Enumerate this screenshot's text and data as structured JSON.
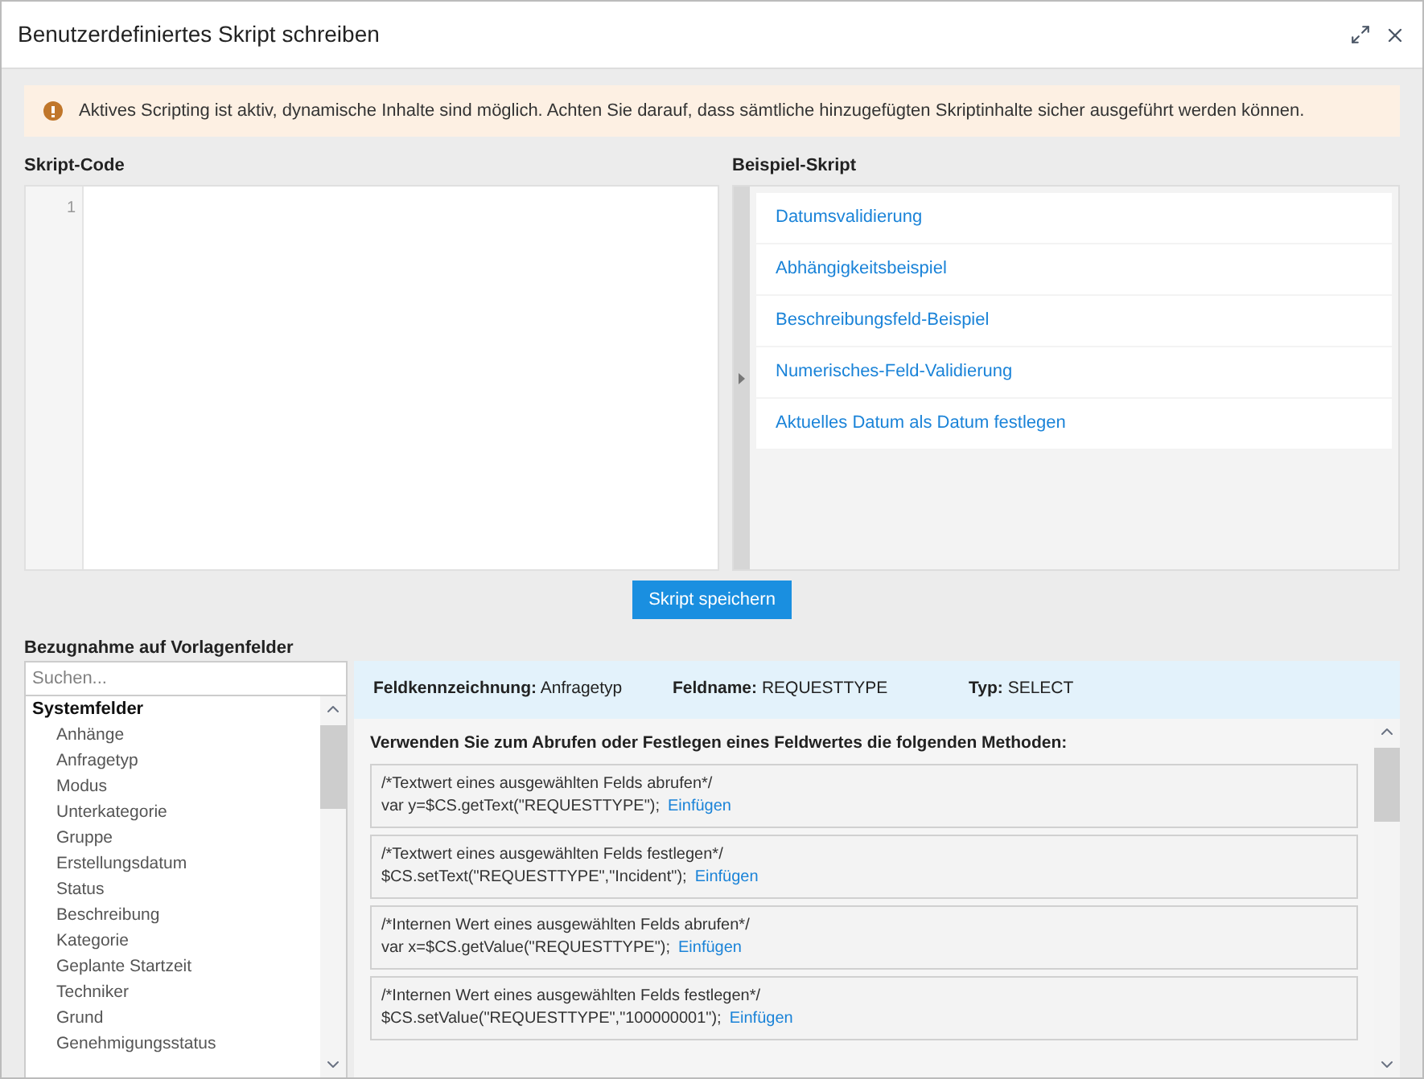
{
  "window": {
    "title": "Benutzerdefiniertes Skript schreiben"
  },
  "alert": {
    "text": "Aktives Scripting ist aktiv, dynamische Inhalte sind möglich. Achten Sie darauf, dass sämtliche hinzugefügten Skriptinhalte sicher ausgeführt werden können."
  },
  "script_code": {
    "label": "Skript-Code",
    "line_numbers": [
      "1"
    ]
  },
  "example_scripts": {
    "label": "Beispiel-Skript",
    "items": [
      "Datumsvalidierung",
      "Abhängigkeitsbeispiel",
      "Beschreibungsfeld-Beispiel",
      "Numerisches-Feld-Validierung",
      "Aktuelles Datum als Datum festlegen"
    ]
  },
  "save_button": "Skript speichern",
  "template_fields": {
    "label": "Bezugnahme auf Vorlagenfelder",
    "search": {
      "placeholder": "Suchen..."
    },
    "groups": [
      {
        "label": "Systemfelder",
        "children": [
          "Anhänge",
          "Anfragetyp",
          "Modus",
          "Unterkategorie",
          "Gruppe",
          "Erstellungsdatum",
          "Status",
          "Beschreibung",
          "Kategorie",
          "Geplante Startzeit",
          "Techniker",
          "Grund",
          "Genehmigungsstatus"
        ]
      }
    ]
  },
  "field_info": [
    {
      "label": "Feldkennzeichnung:",
      "value": "Anfragetyp"
    },
    {
      "label": "Feldname:",
      "value": "REQUESTTYPE"
    },
    {
      "label": "Typ:",
      "value": "SELECT"
    }
  ],
  "methods": {
    "heading": "Verwenden Sie zum Abrufen oder Festlegen eines Feldwertes die folgenden Methoden:",
    "items": [
      {
        "comment": "/*Textwert eines ausgewählten Felds abrufen*/",
        "code": "var y=$CS.getText(\"REQUESTTYPE\");",
        "link": "Einfügen"
      },
      {
        "comment": "/*Textwert eines ausgewählten Felds festlegen*/",
        "code": "$CS.setText(\"REQUESTTYPE\",\"Incident\");",
        "link": "Einfügen"
      },
      {
        "comment": "/*Internen Wert eines ausgewählten Felds abrufen*/",
        "code": "var x=$CS.getValue(\"REQUESTTYPE\");",
        "link": "Einfügen"
      },
      {
        "comment": "/*Internen Wert eines ausgewählten Felds festlegen*/",
        "code": "$CS.setValue(\"REQUESTTYPE\",\"100000001\");",
        "link": "Einfügen"
      }
    ]
  }
}
